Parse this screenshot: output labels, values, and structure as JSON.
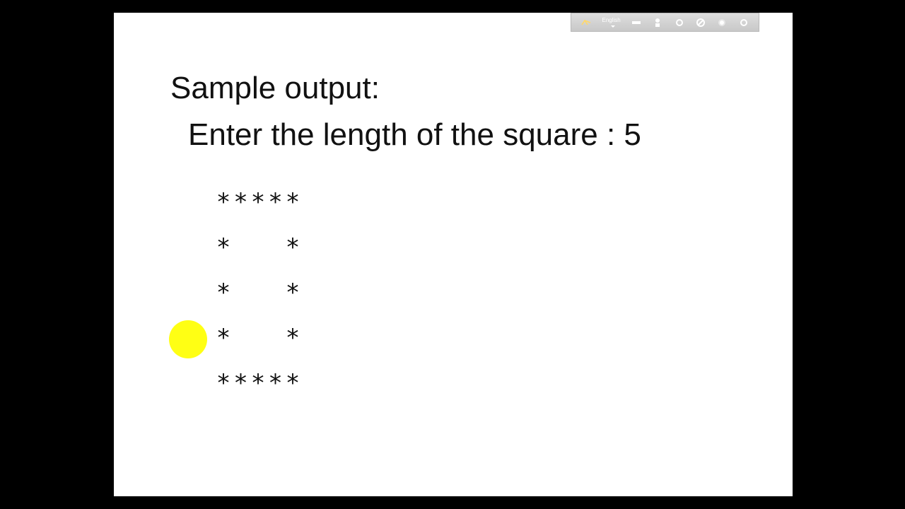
{
  "slide": {
    "title": "Sample output:",
    "prompt": "Enter the length of the square : 5",
    "rows": [
      {
        "chars": [
          "*",
          "*",
          "*",
          "*",
          "*"
        ]
      },
      {
        "chars": [
          "*",
          " ",
          " ",
          " ",
          "*"
        ]
      },
      {
        "chars": [
          "*",
          " ",
          " ",
          " ",
          "*"
        ]
      },
      {
        "chars": [
          "*",
          " ",
          " ",
          " ",
          "*"
        ]
      },
      {
        "chars": [
          "*",
          "*",
          "*",
          "*",
          "*"
        ]
      }
    ]
  },
  "language_bar": {
    "language": "English",
    "icons": [
      "keyboard-icon",
      "chalk-icon",
      "person-icon",
      "settings-circle-icon",
      "pen-icon",
      "help-icon",
      "close-circle-icon"
    ]
  },
  "colors": {
    "background": "#000000",
    "slide": "#ffffff",
    "highlight": "#ffff00",
    "text": "#111111"
  }
}
